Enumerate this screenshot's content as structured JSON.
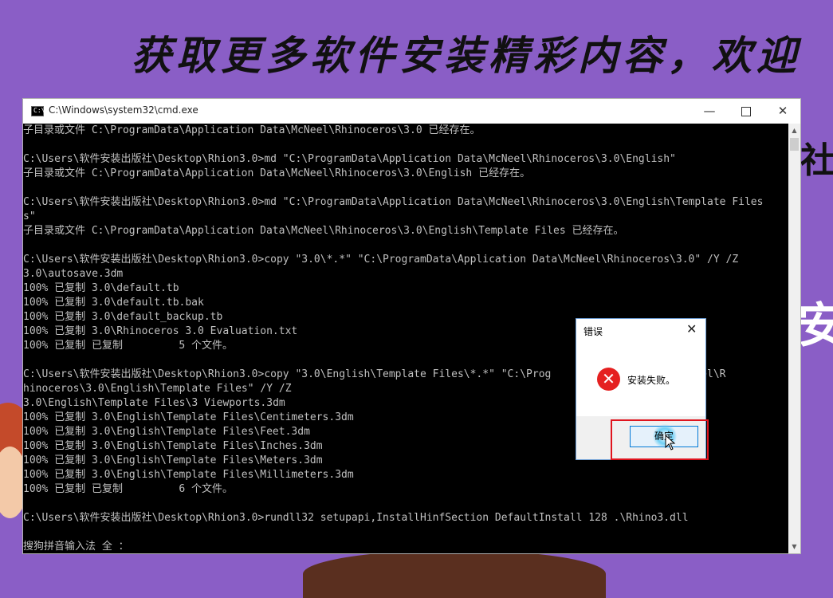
{
  "background": {
    "color": "#8a5ec6",
    "banner_text": "获取更多软件安装精彩内容，欢迎",
    "side_glyph_1": "社",
    "side_glyph_2": "安"
  },
  "cmd_window": {
    "title": "C:\\Windows\\system32\\cmd.exe",
    "icon": "cmd-icon",
    "buttons": {
      "minimize": "—",
      "close": "✕"
    },
    "lines": [
      "子目录或文件 C:\\ProgramData\\Application Data\\McNeel\\Rhinoceros\\3.0 已经存在。",
      "",
      "C:\\Users\\软件安装出版社\\Desktop\\Rhion3.0>md \"C:\\ProgramData\\Application Data\\McNeel\\Rhinoceros\\3.0\\English\"",
      "子目录或文件 C:\\ProgramData\\Application Data\\McNeel\\Rhinoceros\\3.0\\English 已经存在。",
      "",
      "C:\\Users\\软件安装出版社\\Desktop\\Rhion3.0>md \"C:\\ProgramData\\Application Data\\McNeel\\Rhinoceros\\3.0\\English\\Template Files",
      "s\"",
      "子目录或文件 C:\\ProgramData\\Application Data\\McNeel\\Rhinoceros\\3.0\\English\\Template Files 已经存在。",
      "",
      "C:\\Users\\软件安装出版社\\Desktop\\Rhion3.0>copy \"3.0\\*.*\" \"C:\\ProgramData\\Application Data\\McNeel\\Rhinoceros\\3.0\" /Y /Z",
      "3.0\\autosave.3dm",
      "100% 已复制 3.0\\default.tb",
      "100% 已复制 3.0\\default.tb.bak",
      "100% 已复制 3.0\\default_backup.tb",
      "100% 已复制 3.0\\Rhinoceros 3.0 Evaluation.txt",
      "100% 已复制 已复制         5 个文件。",
      "",
      "C:\\Users\\软件安装出版社\\Desktop\\Rhion3.0>copy \"3.0\\English\\Template Files\\*.*\" \"C:\\Prog               Data\\McNeel\\R",
      "hinoceros\\3.0\\English\\Template Files\" /Y /Z",
      "3.0\\English\\Template Files\\3 Viewports.3dm",
      "100% 已复制 3.0\\English\\Template Files\\Centimeters.3dm",
      "100% 已复制 3.0\\English\\Template Files\\Feet.3dm",
      "100% 已复制 3.0\\English\\Template Files\\Inches.3dm",
      "100% 已复制 3.0\\English\\Template Files\\Meters.3dm",
      "100% 已复制 3.0\\English\\Template Files\\Millimeters.3dm",
      "100% 已复制 已复制         6 个文件。",
      "",
      "C:\\Users\\软件安装出版社\\Desktop\\Rhion3.0>rundll32 setupapi,InstallHinfSection DefaultInstall 128 .\\Rhino3.dll",
      "",
      "搜狗拼音输入法 全 ："
    ]
  },
  "dialog": {
    "title": "错误",
    "close": "✕",
    "icon": "error-icon",
    "icon_glyph": "✕",
    "message": "安装失败。",
    "ok_label": "确定",
    "highlight_color": "#e0141e"
  }
}
